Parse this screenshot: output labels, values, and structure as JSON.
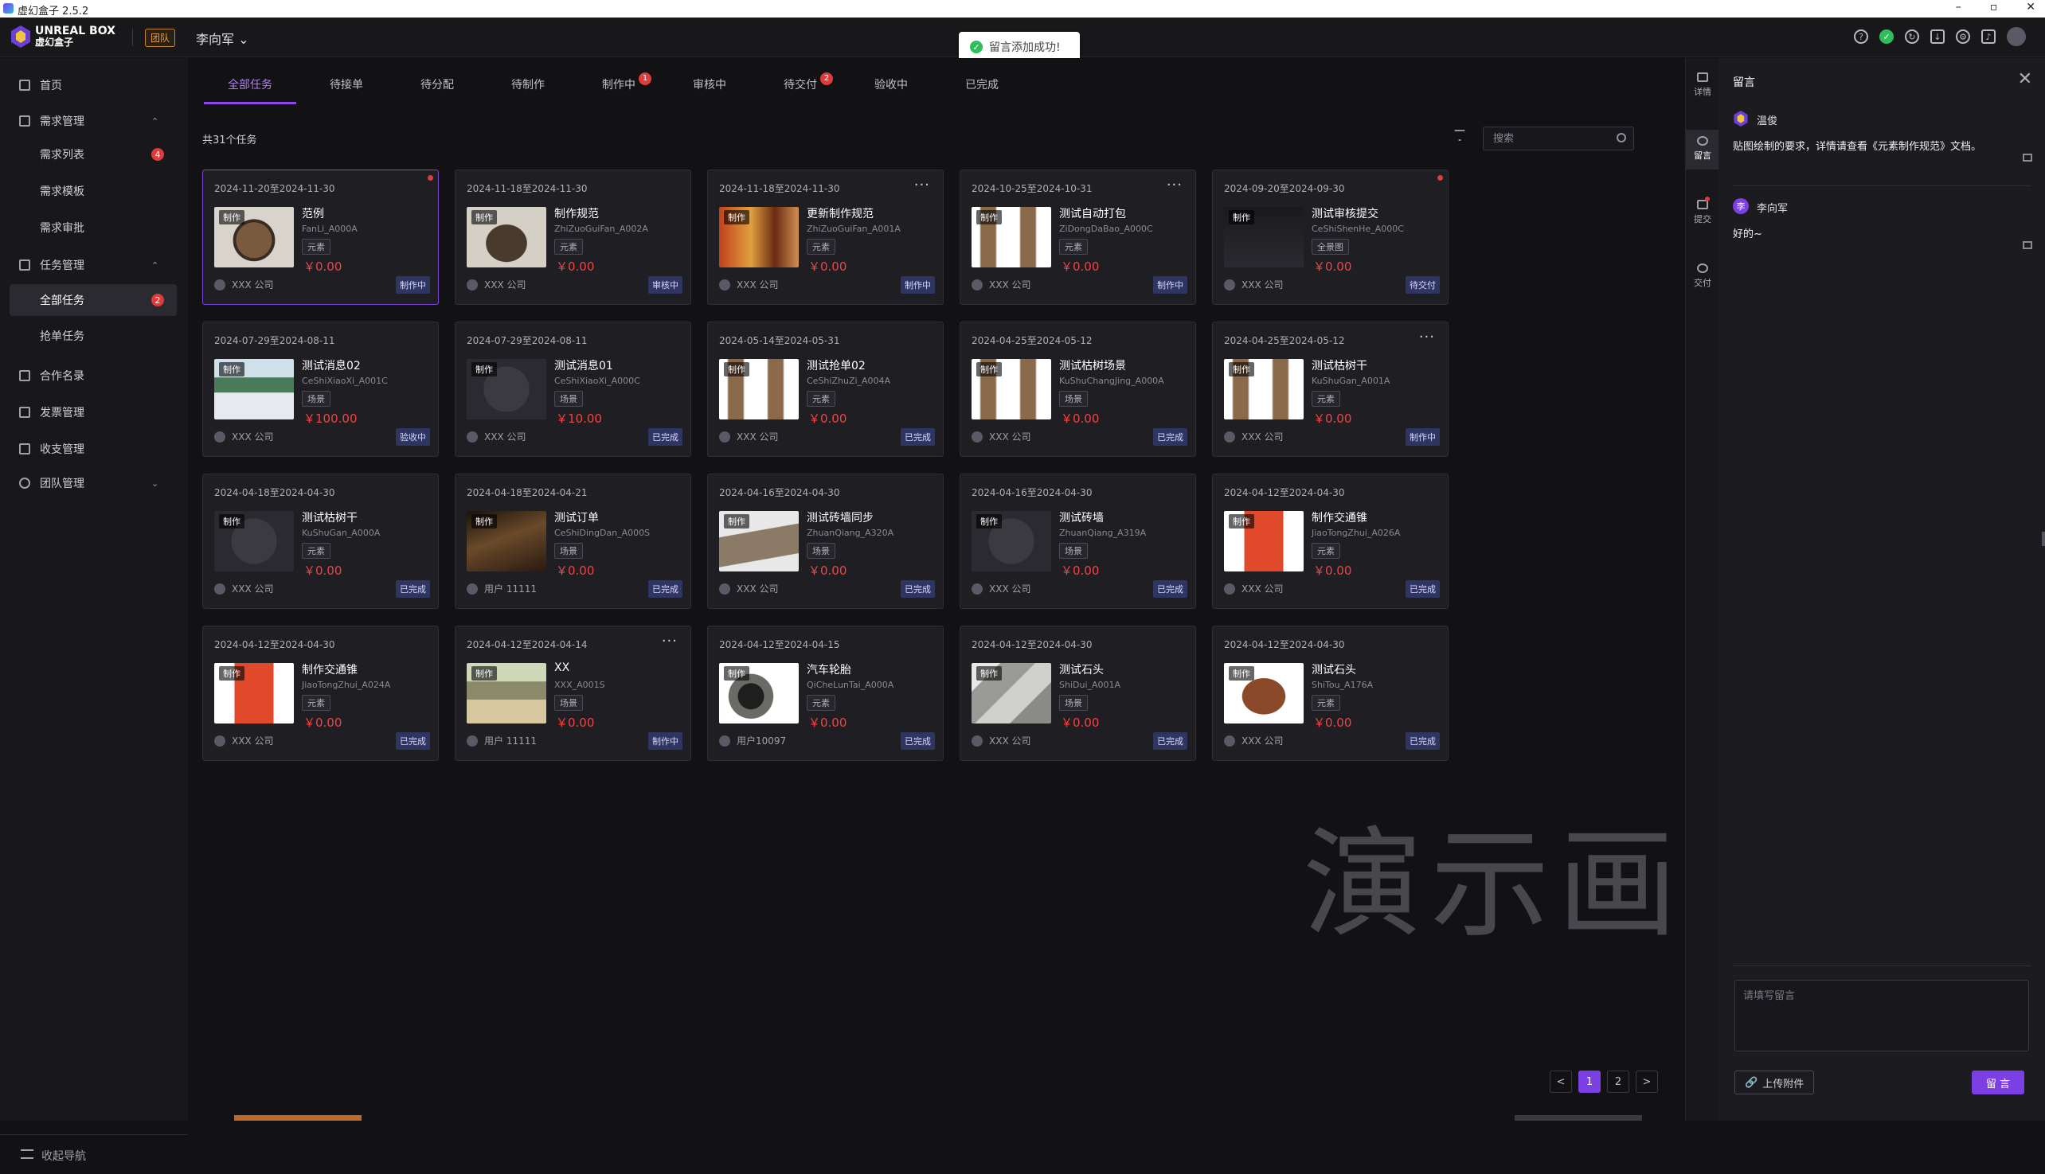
{
  "window": {
    "title": "虚幻盒子 2.5.2",
    "buttons": [
      "–",
      "▫",
      "✕"
    ]
  },
  "header": {
    "logo_line1": "UNREAL BOX",
    "logo_line2": "虚幻盒子",
    "team_tag": "团队",
    "user": "李向军",
    "icons": [
      "help-icon",
      "status-ok-icon",
      "refresh-icon",
      "download-icon",
      "settings-icon",
      "bell-icon",
      "avatar"
    ]
  },
  "toast": {
    "text": "留言添加成功!"
  },
  "sidebar": {
    "items": [
      {
        "label": "首页"
      },
      {
        "label": "需求管理"
      },
      {
        "label": "需求列表",
        "badge": "4"
      },
      {
        "label": "需求模板"
      },
      {
        "label": "需求审批"
      },
      {
        "label": "任务管理"
      },
      {
        "label": "全部任务",
        "badge": "2"
      },
      {
        "label": "抢单任务"
      },
      {
        "label": "合作名录"
      },
      {
        "label": "发票管理"
      },
      {
        "label": "收支管理"
      },
      {
        "label": "团队管理"
      }
    ],
    "collapse_label": "收起导航"
  },
  "tabs": [
    {
      "label": "全部任务"
    },
    {
      "label": "待接单"
    },
    {
      "label": "待分配"
    },
    {
      "label": "待制作"
    },
    {
      "label": "制作中",
      "badge": "1"
    },
    {
      "label": "审核中"
    },
    {
      "label": "待交付",
      "badge": "2"
    },
    {
      "label": "验收中"
    },
    {
      "label": "已完成"
    }
  ],
  "task_count": "共31个任务",
  "search": {
    "placeholder": "搜索"
  },
  "thumb_tag": "制作",
  "cards": [
    {
      "date": "2024-11-20至2024-11-30",
      "name": "范例",
      "code": "FanLi_A000A",
      "type": "元素",
      "price": "￥0.00",
      "owner": "XXX 公司",
      "status": "制作中"
    },
    {
      "date": "2024-11-18至2024-11-30",
      "name": "制作规范",
      "code": "ZhiZuoGuiFan_A002A",
      "type": "元素",
      "price": "￥0.00",
      "owner": "XXX 公司",
      "status": "审核中"
    },
    {
      "date": "2024-11-18至2024-11-30",
      "name": "更新制作规范",
      "code": "ZhiZuoGuiFan_A001A",
      "type": "元素",
      "price": "￥0.00",
      "owner": "XXX 公司",
      "status": "制作中"
    },
    {
      "date": "2024-10-25至2024-10-31",
      "name": "测试自动打包",
      "code": "ZiDongDaBao_A000C",
      "type": "元素",
      "price": "￥0.00",
      "owner": "XXX 公司",
      "status": "制作中"
    },
    {
      "date": "2024-09-20至2024-09-30",
      "name": "测试审核提交",
      "code": "CeShiShenHe_A000C",
      "type": "全景图",
      "price": "￥0.00",
      "owner": "XXX 公司",
      "status": "待交付"
    },
    {
      "date": "2024-07-29至2024-08-11",
      "name": "测试消息02",
      "code": "CeShiXiaoXi_A001C",
      "type": "场景",
      "price": "￥100.00",
      "owner": "XXX 公司",
      "status": "验收中"
    },
    {
      "date": "2024-07-29至2024-08-11",
      "name": "测试消息01",
      "code": "CeShiXiaoXi_A000C",
      "type": "场景",
      "price": "￥10.00",
      "owner": "XXX 公司",
      "status": "已完成"
    },
    {
      "date": "2024-05-14至2024-05-31",
      "name": "测试抢单02",
      "code": "CeShiZhuZi_A004A",
      "type": "元素",
      "price": "￥0.00",
      "owner": "XXX 公司",
      "status": "已完成"
    },
    {
      "date": "2024-04-25至2024-05-12",
      "name": "测试枯树场景",
      "code": "KuShuChangJing_A000A",
      "type": "场景",
      "price": "￥0.00",
      "owner": "XXX 公司",
      "status": "已完成"
    },
    {
      "date": "2024-04-25至2024-05-12",
      "name": "测试枯树干",
      "code": "KuShuGan_A001A",
      "type": "元素",
      "price": "￥0.00",
      "owner": "XXX 公司",
      "status": "制作中"
    },
    {
      "date": "2024-04-18至2024-04-30",
      "name": "测试枯树干",
      "code": "KuShuGan_A000A",
      "type": "元素",
      "price": "￥0.00",
      "owner": "XXX 公司",
      "status": "已完成"
    },
    {
      "date": "2024-04-18至2024-04-21",
      "name": "测试订单",
      "code": "CeShiDingDan_A000S",
      "type": "场景",
      "price": "￥0.00",
      "owner": "用户 11111",
      "status": "已完成"
    },
    {
      "date": "2024-04-16至2024-04-30",
      "name": "测试砖墙同步",
      "code": "ZhuanQiang_A320A",
      "type": "场景",
      "price": "￥0.00",
      "owner": "XXX 公司",
      "status": "已完成"
    },
    {
      "date": "2024-04-16至2024-04-30",
      "name": "测试砖墙",
      "code": "ZhuanQiang_A319A",
      "type": "场景",
      "price": "￥0.00",
      "owner": "XXX 公司",
      "status": "已完成"
    },
    {
      "date": "2024-04-12至2024-04-30",
      "name": "制作交通锥",
      "code": "JiaoTongZhui_A026A",
      "type": "元素",
      "price": "￥0.00",
      "owner": "XXX 公司",
      "status": "已完成"
    },
    {
      "date": "2024-04-12至2024-04-30",
      "name": "制作交通锥",
      "code": "JiaoTongZhui_A024A",
      "type": "元素",
      "price": "￥0.00",
      "owner": "XXX 公司",
      "status": "已完成"
    },
    {
      "date": "2024-04-12至2024-04-14",
      "name": "XX",
      "code": "XXX_A001S",
      "type": "场景",
      "price": "￥0.00",
      "owner": "用户 11111",
      "status": "制作中"
    },
    {
      "date": "2024-04-12至2024-04-15",
      "name": "汽车轮胎",
      "code": "QiCheLunTai_A000A",
      "type": "元素",
      "price": "￥0.00",
      "owner": "用户10097",
      "status": "已完成"
    },
    {
      "date": "2024-04-12至2024-04-30",
      "name": "测试石头",
      "code": "ShiDui_A001A",
      "type": "场景",
      "price": "￥0.00",
      "owner": "XXX 公司",
      "status": "已完成"
    },
    {
      "date": "2024-04-12至2024-04-30",
      "name": "测试石头",
      "code": "ShiTou_A176A",
      "type": "元素",
      "price": "￥0.00",
      "owner": "XXX 公司",
      "status": "已完成"
    }
  ],
  "pagination": {
    "prev": "<",
    "pages": [
      "1",
      "2"
    ],
    "next": ">"
  },
  "watermark": "演示画面",
  "rail": [
    {
      "label": "详情"
    },
    {
      "label": "留言"
    },
    {
      "label": "提交"
    },
    {
      "label": "交付"
    }
  ],
  "comments": {
    "title": "留言",
    "messages": [
      {
        "avatar": "",
        "author": "温俊",
        "text": "贴图绘制的要求，详情请查看《元素制作规范》文档。"
      },
      {
        "avatar": "李",
        "author": "李向军",
        "text": "好的~"
      }
    ],
    "input_placeholder": "请填写留言",
    "upload_label": "上传附件",
    "send_label": "留 言"
  },
  "colors": {
    "accent": "#7b3fe4",
    "danger": "#e03b3b",
    "price": "#f04444",
    "status_bg": "#2e3560"
  }
}
